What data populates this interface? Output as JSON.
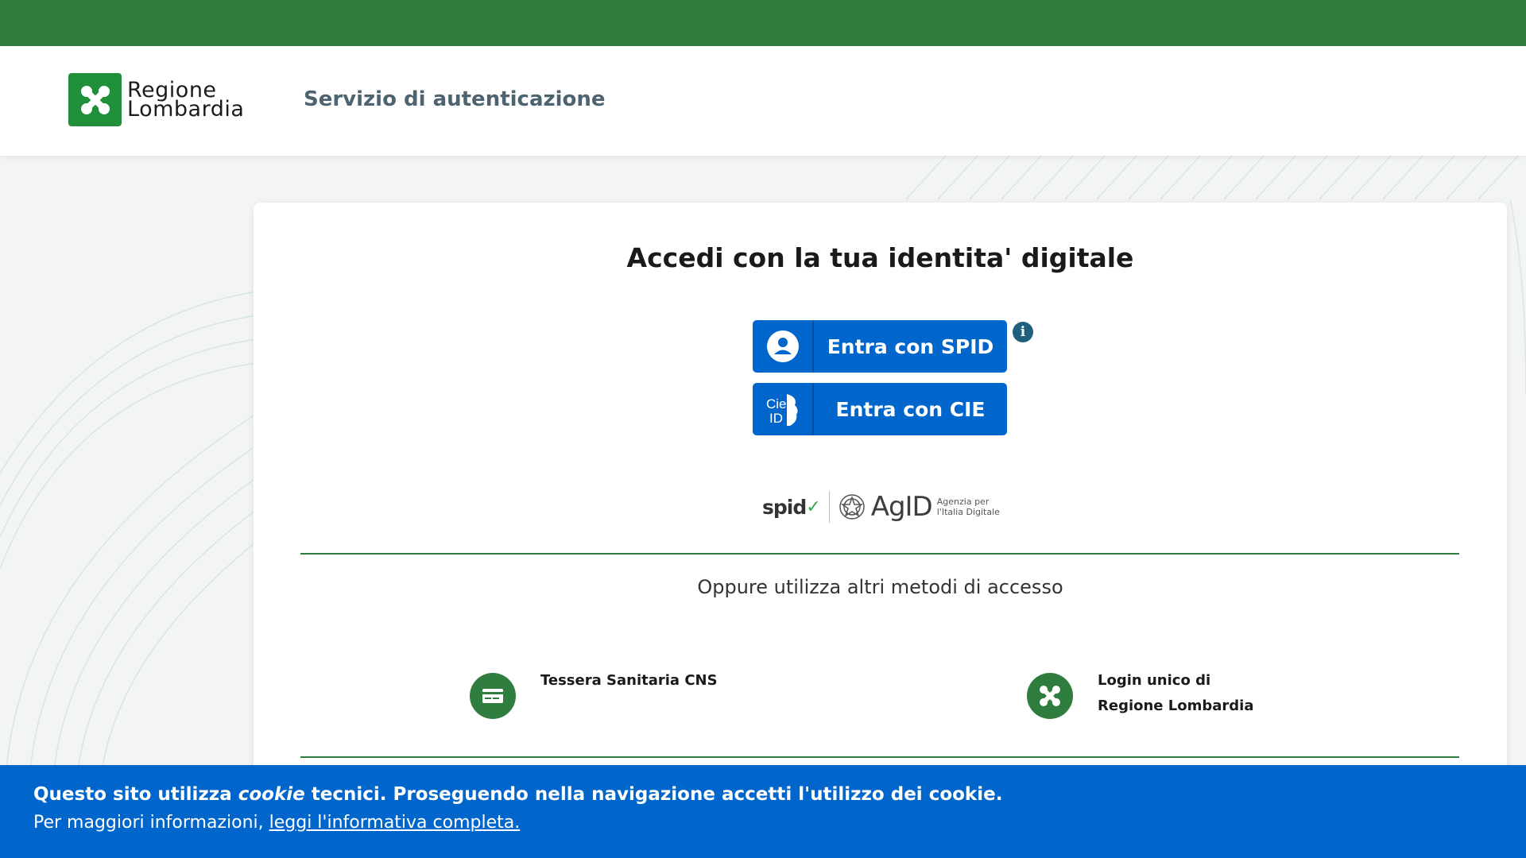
{
  "header": {
    "logo_line1": "Regione",
    "logo_line2": "Lombardia",
    "service_title": "Servizio di autenticazione"
  },
  "card": {
    "title": "Accedi con la tua identita' digitale",
    "spid_button": {
      "label": "Entra con SPID",
      "icon": "user-circle-icon"
    },
    "cie_button": {
      "label": "Entra con CIE",
      "icon_text_1": "Cie",
      "icon_text_2": "ID"
    },
    "info_icon": "i",
    "brands": {
      "spid": "spid",
      "agid": "AgID",
      "agid_sub_1": "Agenzia per",
      "agid_sub_2": "l'Italia Digitale"
    },
    "other_methods": "Oppure utilizza altri metodi di accesso",
    "methods": [
      {
        "label": "Tessera Sanitaria CNS",
        "icon": "card-icon"
      },
      {
        "label": "Login unico di Regione Lombardia",
        "icon": "regione-logo-icon"
      }
    ]
  },
  "cookie_banner": {
    "line1_pre": "Questo sito utilizza ",
    "line1_em": "cookie",
    "line1_post": " tecnici. Proseguendo nella navigazione accetti l'utilizzo dei cookie.",
    "line2_pre": "Per maggiori informazioni, ",
    "line2_link": "leggi l'informativa completa."
  },
  "colors": {
    "green": "#2e7d3e",
    "blue": "#0066cc",
    "logo_green": "#1f8f3a"
  }
}
